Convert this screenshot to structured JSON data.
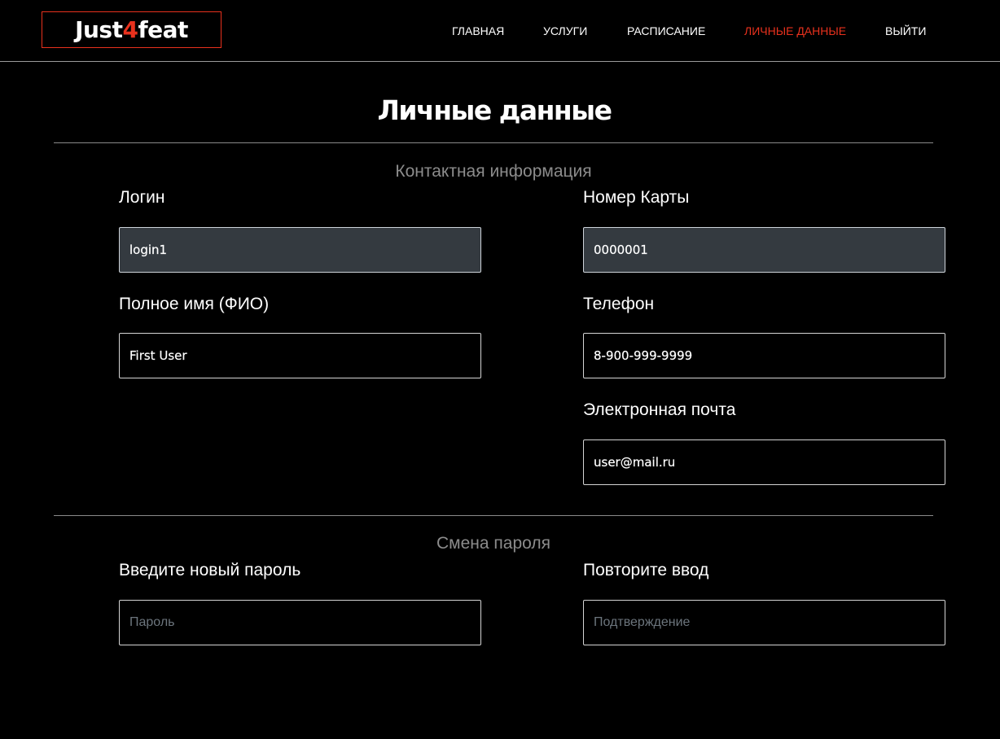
{
  "header": {
    "logo_prefix": "Just",
    "logo_accent": "4",
    "logo_suffix": "feat",
    "nav": [
      {
        "label": "ГЛАВНАЯ",
        "active": false
      },
      {
        "label": "УСЛУГИ",
        "active": false
      },
      {
        "label": "РАСПИСАНИЕ",
        "active": false
      },
      {
        "label": "ЛИЧНЫЕ ДАННЫЕ",
        "active": true
      },
      {
        "label": "ВЫЙТИ",
        "active": false
      }
    ]
  },
  "page": {
    "title": "Личные данные"
  },
  "contact": {
    "section_title": "Контактная информация",
    "login": {
      "label": "Логин",
      "value": "login1"
    },
    "card": {
      "label": "Номер Карты",
      "value": "0000001"
    },
    "full_name": {
      "label": "Полное имя (ФИО)",
      "value": "First User"
    },
    "phone": {
      "label": "Телефон",
      "value": "8-900-999-9999"
    },
    "email": {
      "label": "Электронная почта",
      "value": "user@mail.ru"
    }
  },
  "password": {
    "section_title": "Смена пароля",
    "new": {
      "label": "Введите новый пароль",
      "placeholder": "Пароль"
    },
    "confirm": {
      "label": "Повторите ввод",
      "placeholder": "Подтверждение"
    }
  },
  "colors": {
    "background": "#000000",
    "accent": "#e8311d",
    "readonly_field": "#343a40",
    "muted_text": "#8c8c8c"
  }
}
